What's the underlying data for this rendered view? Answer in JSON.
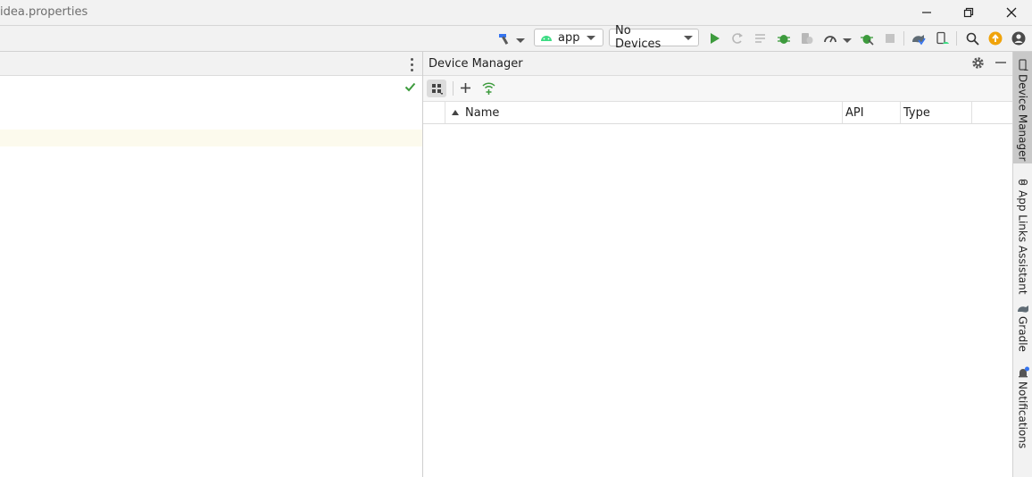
{
  "window": {
    "title": "idea.properties"
  },
  "toolbar": {
    "run_config": "app",
    "device_selector": "No Devices",
    "icons": [
      "hammer-icon",
      "run-icon",
      "apply-changes-icon",
      "apply-code-changes-icon",
      "debug-icon",
      "attach-debugger-icon",
      "profile-icon",
      "attach-process-icon",
      "stop-icon",
      "gradle-sync-icon",
      "device-manager-icon",
      "search-icon",
      "update-icon",
      "account-icon"
    ]
  },
  "device_manager": {
    "title": "Device Manager",
    "columns": [
      {
        "label": "Name",
        "sorted": "ascending"
      },
      {
        "label": "API"
      },
      {
        "label": "Type"
      }
    ]
  },
  "tool_strip": {
    "items": [
      {
        "label": "Device Manager",
        "active": true
      },
      {
        "label": "App Links Assistant"
      },
      {
        "label": "Gradle"
      },
      {
        "label": "Notifications"
      }
    ]
  },
  "colors": {
    "run_green": "#3d9b3d",
    "accent_blue": "#3574f0",
    "update_orange": "#f0a30a",
    "highlight_line": "#fcfaed"
  }
}
